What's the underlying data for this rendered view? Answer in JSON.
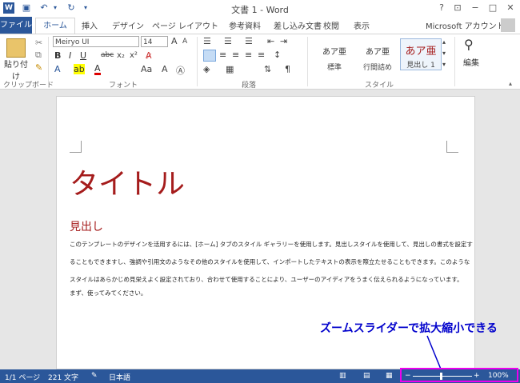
{
  "titlebar": {
    "title": "文書 1 - Word",
    "help": "?",
    "minimize": "−",
    "restore": "□",
    "close": "✕"
  },
  "tabs": {
    "file": "ファイル",
    "home": "ホーム",
    "insert": "挿入",
    "design": "デザイン",
    "layout": "ページ レイアウト",
    "references": "参考資料",
    "mailings": "差し込み文書",
    "review": "校閲",
    "view": "表示",
    "account": "Microsoft アカウント"
  },
  "ribbon": {
    "paste": "貼り付け",
    "font_name": "Meiryo UI",
    "font_size": "14",
    "styles": [
      {
        "sample": "あア亜",
        "name": "標準"
      },
      {
        "sample": "あア亜",
        "name": "行間詰め"
      },
      {
        "sample": "あア亜",
        "name": "見出し 1"
      }
    ],
    "edit": "編集",
    "groups": {
      "clipboard": "クリップボード",
      "font": "フォント",
      "paragraph": "段落",
      "style": "スタイル"
    }
  },
  "document": {
    "title": "タイトル",
    "heading": "見出し",
    "body": [
      "このテンプレートのデザインを活用するには、[ホーム] タブのスタイル ギャラリーを使用します。見出しスタイルを使用して、見出しの書式を設定す",
      "ることもできますし、強調や引用文のようなその他のスタイルを使用して、インポートしたテキストの表示を際立たせることもできます。このような",
      "スタイルはあらかじめ見栄えよく設定されており、合わせて使用することにより、ユーザーのアイディアをうまく伝えられるようになっています。"
    ],
    "closing": "まず、使ってみてください。"
  },
  "status": {
    "page": "1/1 ページ",
    "words": "221 文字",
    "language": "日本語",
    "zoom": "100%"
  },
  "annotation": "ズームスライダーで拡大縮小できる",
  "colors": {
    "accent": "#2b579a",
    "heading": "#a51c1c",
    "annotation": "#0000cc",
    "highlight": "#ee00ee"
  }
}
